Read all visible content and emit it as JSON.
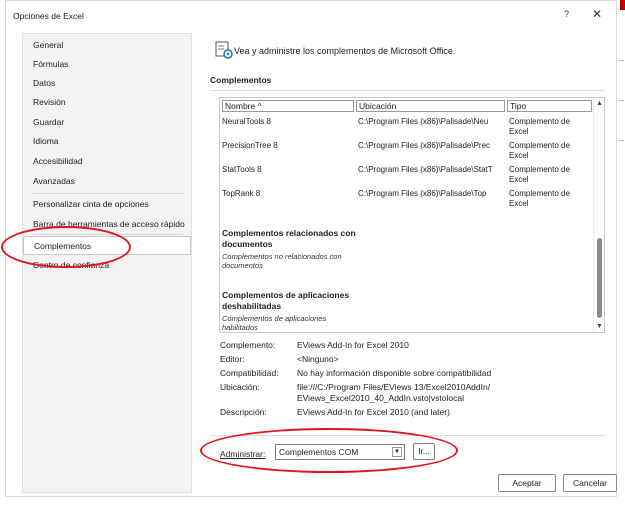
{
  "window": {
    "title": "Opciones de Excel",
    "help_label": "?",
    "close_label": "✕"
  },
  "sidebar": {
    "items": [
      {
        "label": "General"
      },
      {
        "label": "Fórmulas"
      },
      {
        "label": "Datos"
      },
      {
        "label": "Revisión"
      },
      {
        "label": "Guardar"
      },
      {
        "label": "Idioma"
      },
      {
        "label": "Accesibilidad"
      },
      {
        "label": "Avanzadas"
      },
      {
        "label": "Personalizar cinta de opciones"
      },
      {
        "label": "Barra de herramientas de acceso rápido"
      },
      {
        "label": "Complementos",
        "selected": true
      },
      {
        "label": "Centro de confianza"
      }
    ]
  },
  "main": {
    "heading": "Vea y administre los complementos de Microsoft Office.",
    "heading_icon": "gear-addins-icon",
    "section_title": "Complementos",
    "list": {
      "columns": [
        "Nombre ^",
        "Ubicación",
        "Tipo"
      ],
      "rows": [
        {
          "name": "NeuralTools 8",
          "location": "C:\\Program Files (x86)\\Palisade\\Neu",
          "type": "Complemento de Excel"
        },
        {
          "name": "PrecisionTree 8",
          "location": "C:\\Program Files (x86)\\Palisade\\Prec",
          "type": "Complemento de Excel"
        },
        {
          "name": "StatTools 8",
          "location": "C:\\Program Files (x86)\\Palisade\\StatT",
          "type": "Complemento de Excel"
        },
        {
          "name": "TopRank 8",
          "location": "C:\\Program Files (x86)\\Palisade\\Top",
          "type": "Complemento de Excel"
        }
      ],
      "groups": [
        {
          "title": "Complementos relacionados con documentos",
          "subtitle": "Complementos no relacionados con documentos"
        },
        {
          "title": "Complementos de aplicaciones deshabilitadas",
          "subtitle": "Complementos de aplicaciones habilitados"
        }
      ]
    },
    "details": {
      "addin_label": "Complemento:",
      "addin_value": "EViews Add-In for Excel 2010",
      "editor_label": "Editor:",
      "editor_value": "<Ninguno>",
      "compat_label": "Compatibilidad:",
      "compat_value": "No hay información disponible sobre compatibilidad",
      "location_label": "Ubicación:",
      "location_value": "file:///C:/Program Files/EViews 13/Excel2010AddIn/ EViews_Excel2010_40_AddIn.vsto|vstolocal",
      "description_label": "Descripción:",
      "description_value": "EViews Add-In for Excel 2010 (and later)"
    },
    "manage": {
      "label": "Administrar:",
      "selected": "Complementos COM",
      "go_label": "Ir..."
    }
  },
  "footer": {
    "ok_label": "Aceptar",
    "cancel_label": "Cancelar"
  },
  "colors": {
    "annotation": "#e0161e",
    "sidebar_bg": "#f3f3f3"
  }
}
